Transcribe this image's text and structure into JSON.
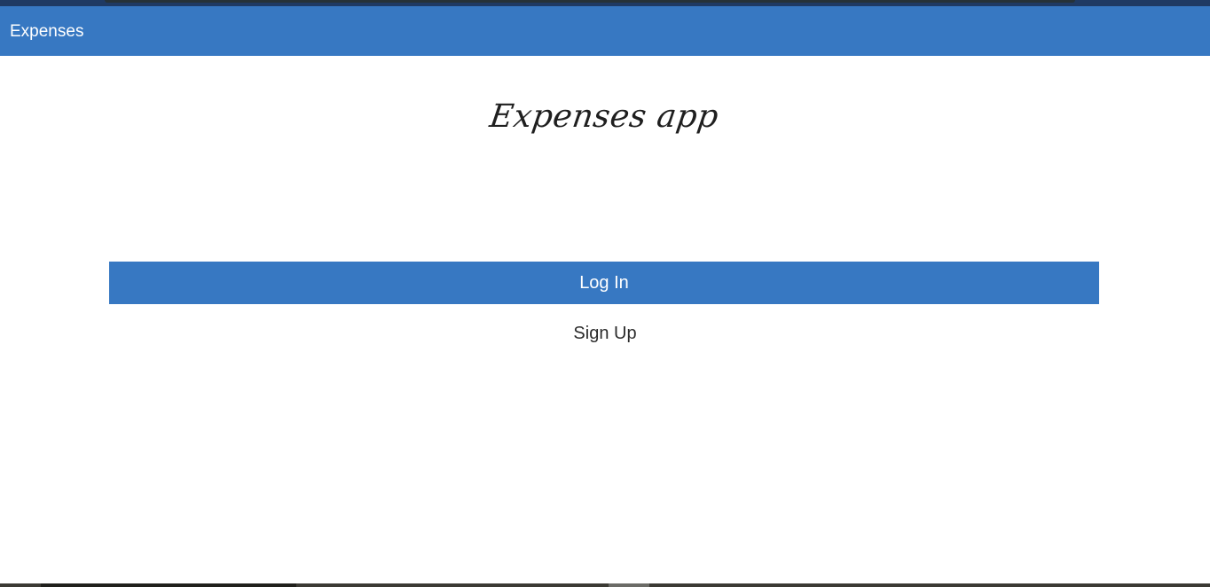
{
  "app_bar": {
    "title": "Expenses",
    "color": "#3778c2"
  },
  "main": {
    "heading": "Expenses app",
    "login_button_label": "Log In",
    "signup_link_label": "Sign Up"
  }
}
